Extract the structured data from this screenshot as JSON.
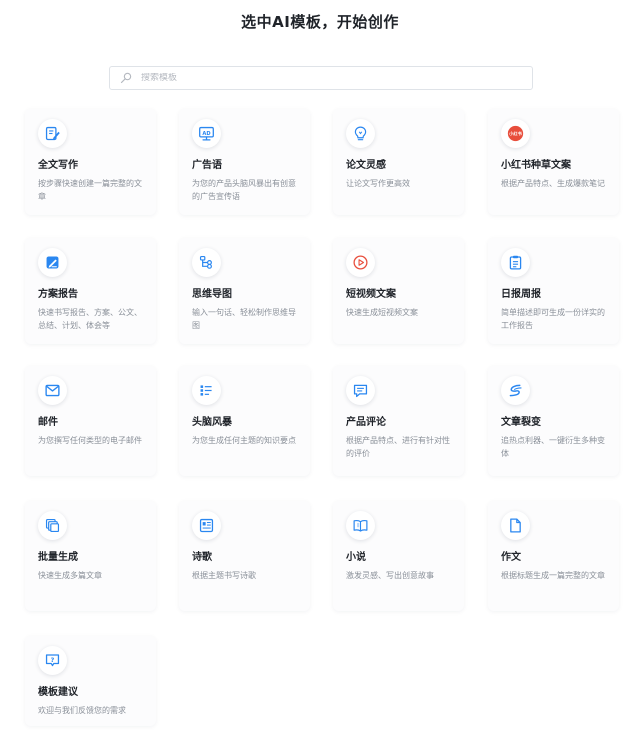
{
  "page": {
    "title": "选中AI模板，开始创作"
  },
  "search": {
    "placeholder": "搜索模板",
    "value": ""
  },
  "colors": {
    "accent": "#2a87f0",
    "red": "#e84e3c",
    "text": "#1f2329",
    "muted": "#8a9099"
  },
  "templates": [
    {
      "title": "全文写作",
      "desc": "按步骤快速创建一篇完整的文章",
      "icon": "edit-document-icon"
    },
    {
      "title": "广告语",
      "desc": "为您的产品头脑风暴出有创意的广告宣传语",
      "icon": "ad-board-icon"
    },
    {
      "title": "论文灵感",
      "desc": "让论文写作更高效",
      "icon": "lightbulb-icon"
    },
    {
      "title": "小红书种草文案",
      "desc": "根据产品特点、生成爆款笔记",
      "icon": "xiaohongshu-logo-icon",
      "logo_text": "小红书"
    },
    {
      "title": "方案报告",
      "desc": "快速书写报告、方案、公文、总结、计划、体会等",
      "icon": "pen-note-icon"
    },
    {
      "title": "思维导图",
      "desc": "输入一句话、轻松制作思维导图",
      "icon": "mind-map-icon"
    },
    {
      "title": "短视频文案",
      "desc": "快速生成短视频文案",
      "icon": "video-play-icon"
    },
    {
      "title": "日报周报",
      "desc": "简单描述即可生成一份详实的工作报告",
      "icon": "clipboard-icon"
    },
    {
      "title": "邮件",
      "desc": "为您撰写任何类型的电子邮件",
      "icon": "mail-icon"
    },
    {
      "title": "头脑风暴",
      "desc": "为您生成任何主题的知识要点",
      "icon": "list-icon"
    },
    {
      "title": "产品评论",
      "desc": "根据产品特点、进行有针对性的评价",
      "icon": "comment-icon"
    },
    {
      "title": "文章裂变",
      "desc": "追热点利器、一键衍生多种变体",
      "icon": "swirl-icon"
    },
    {
      "title": "批量生成",
      "desc": "快速生成多篇文章",
      "icon": "stack-copy-icon"
    },
    {
      "title": "诗歌",
      "desc": "根据主题书写诗歌",
      "icon": "newspaper-icon"
    },
    {
      "title": "小说",
      "desc": "激发灵感、写出创意故事",
      "icon": "open-book-icon"
    },
    {
      "title": "作文",
      "desc": "根据标题生成一篇完整的文章",
      "icon": "file-icon"
    },
    {
      "title": "模板建议",
      "desc": "欢迎与我们反馈您的需求",
      "icon": "question-chat-icon"
    }
  ]
}
